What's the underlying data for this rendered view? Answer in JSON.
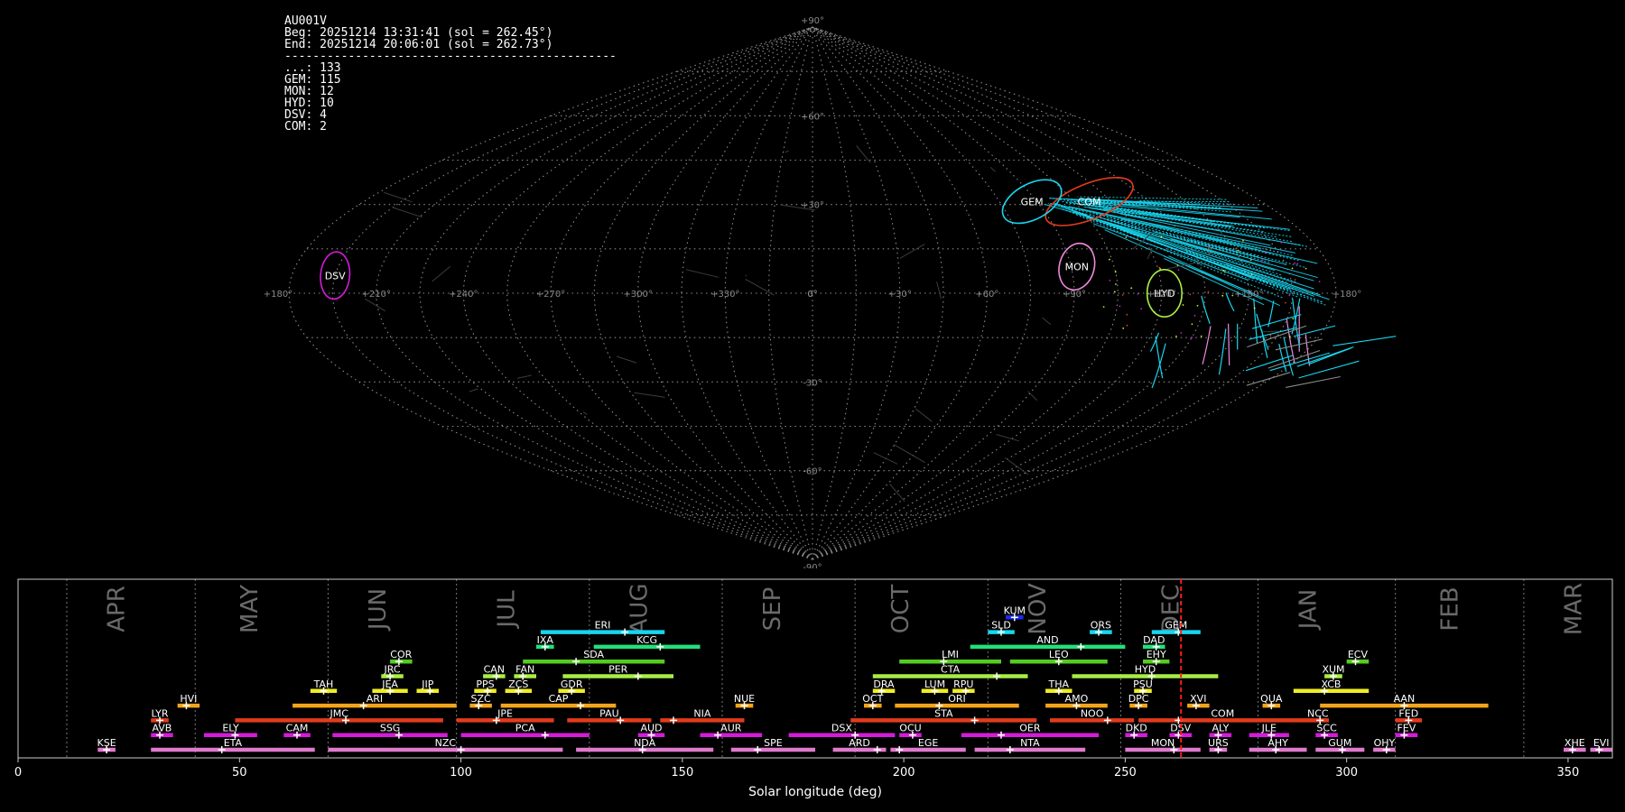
{
  "info": {
    "station": "AU001V",
    "beg": "Beg: 20251214 13:31:41 (sol = 262.45°)",
    "end": "End: 20251214 20:06:01 (sol = 262.73°)",
    "separator": "-----------------------------------------------",
    "counts": [
      "...: 133",
      "GEM: 115",
      "MON: 12",
      "HYD: 10",
      "DSV: 4",
      "COM: 2"
    ]
  },
  "sky_map": {
    "projection": "sinusoidal",
    "lat_labels": [
      "+90°",
      "+60°",
      "+30°",
      "0°",
      "-30°",
      "-60°",
      "-90°"
    ],
    "lat_values": [
      90,
      60,
      30,
      0,
      -30,
      -60,
      -90
    ],
    "lon_labels": [
      {
        "lon": 180,
        "text": "+180°"
      },
      {
        "lon": 150,
        "text": "+150°"
      },
      {
        "lon": 120,
        "text": "+120°"
      },
      {
        "lon": 90,
        "text": "+90°"
      },
      {
        "lon": 60,
        "text": "+60°"
      },
      {
        "lon": 30,
        "text": "+30°"
      },
      {
        "lon": 0,
        "text": "0°"
      },
      {
        "lon": -30,
        "text": "+330°"
      },
      {
        "lon": -60,
        "text": "+300°"
      },
      {
        "lon": -90,
        "text": "+270°"
      },
      {
        "lon": -120,
        "text": "+240°"
      },
      {
        "lon": -150,
        "text": "+210°"
      },
      {
        "lon": -180,
        "text": "+180°"
      }
    ],
    "radiants": [
      {
        "code": "COM",
        "lon": 111,
        "lat": 31,
        "rx_deg": 16,
        "ry_deg": 6,
        "angle": -22,
        "color": "#e33b1c"
      },
      {
        "code": "GEM",
        "lon": 88,
        "lat": 31,
        "rx_deg": 11,
        "ry_deg": 6,
        "angle": -28,
        "color": "#18d5ee"
      },
      {
        "code": "MON",
        "lon": 92,
        "lat": 9,
        "rx_deg": 6,
        "ry_deg": 8,
        "angle": 15,
        "color": "#ee88dd"
      },
      {
        "code": "HYD",
        "lon": 121,
        "lat": 0,
        "rx_deg": 6,
        "ry_deg": 8,
        "angle": 0,
        "color": "#a8ee44"
      },
      {
        "code": "DSV",
        "lon": -165,
        "lat": 6,
        "rx_deg": 5,
        "ry_deg": 8,
        "angle": 5,
        "color": "#d41cd8"
      }
    ]
  },
  "timeline": {
    "xlabel": "Solar longitude (deg)",
    "xlim": [
      0,
      360
    ],
    "xticks": [
      0,
      50,
      100,
      150,
      200,
      250,
      300,
      350
    ],
    "current_sol": 262.6,
    "months": [
      {
        "name": "APR",
        "sol": 24
      },
      {
        "name": "MAY",
        "sol": 54
      },
      {
        "name": "JUN",
        "sol": 83
      },
      {
        "name": "JUL",
        "sol": 112
      },
      {
        "name": "AUG",
        "sol": 142
      },
      {
        "name": "SEP",
        "sol": 172
      },
      {
        "name": "OCT",
        "sol": 201
      },
      {
        "name": "NOV",
        "sol": 232
      },
      {
        "name": "DEC",
        "sol": 262
      },
      {
        "name": "JAN",
        "sol": 293
      },
      {
        "name": "FEB",
        "sol": 325
      },
      {
        "name": "MAR",
        "sol": 353
      }
    ],
    "month_boundaries": [
      11,
      40,
      70,
      99,
      129,
      159,
      189,
      219,
      249,
      280,
      311,
      340
    ],
    "showers": [
      {
        "code": "KUM",
        "start": 223,
        "end": 227,
        "peak": 225,
        "row": 9,
        "color": "#1a2aee"
      },
      {
        "code": "ERI",
        "start": 118,
        "end": 146,
        "peak": 137,
        "row": 8,
        "color": "#18d5ee"
      },
      {
        "code": "SLD",
        "start": 219,
        "end": 225,
        "peak": 222,
        "row": 8,
        "color": "#18d5ee"
      },
      {
        "code": "ORS",
        "start": 242,
        "end": 247,
        "peak": 244,
        "row": 8,
        "color": "#18d5ee"
      },
      {
        "code": "GEM",
        "start": 256,
        "end": 267,
        "peak": 262,
        "row": 8,
        "color": "#18d5ee"
      },
      {
        "code": "IXA",
        "start": 117,
        "end": 121,
        "peak": 119,
        "row": 7,
        "color": "#22e07a"
      },
      {
        "code": "KCG",
        "start": 130,
        "end": 154,
        "peak": 145,
        "row": 7,
        "color": "#22e07a"
      },
      {
        "code": "AND",
        "start": 215,
        "end": 250,
        "peak": 240,
        "row": 7,
        "color": "#22e07a"
      },
      {
        "code": "DAD",
        "start": 254,
        "end": 259,
        "peak": 257,
        "row": 7,
        "color": "#22e07a"
      },
      {
        "code": "COR",
        "start": 84,
        "end": 89,
        "peak": 86,
        "row": 6,
        "color": "#55cc22"
      },
      {
        "code": "SDA",
        "start": 114,
        "end": 146,
        "peak": 126,
        "row": 6,
        "color": "#55cc22"
      },
      {
        "code": "LMI",
        "start": 199,
        "end": 222,
        "peak": 209,
        "row": 6,
        "color": "#55cc22"
      },
      {
        "code": "LEO",
        "start": 224,
        "end": 246,
        "peak": 235,
        "row": 6,
        "color": "#55cc22"
      },
      {
        "code": "EHY",
        "start": 254,
        "end": 260,
        "peak": 257,
        "row": 6,
        "color": "#55cc22"
      },
      {
        "code": "ECV",
        "start": 300,
        "end": 305,
        "peak": 302,
        "row": 6,
        "color": "#55cc22"
      },
      {
        "code": "JRC",
        "start": 82,
        "end": 87,
        "peak": 84,
        "row": 5,
        "color": "#a8ee44"
      },
      {
        "code": "CAN",
        "start": 105,
        "end": 110,
        "peak": 108,
        "row": 5,
        "color": "#a8ee44"
      },
      {
        "code": "FAN",
        "start": 112,
        "end": 117,
        "peak": 114,
        "row": 5,
        "color": "#a8ee44"
      },
      {
        "code": "PER",
        "start": 123,
        "end": 148,
        "peak": 140,
        "row": 5,
        "color": "#a8ee44"
      },
      {
        "code": "CTA",
        "start": 193,
        "end": 228,
        "peak": 221,
        "row": 5,
        "color": "#a8ee44"
      },
      {
        "code": "HYD",
        "start": 238,
        "end": 271,
        "peak": 256,
        "row": 5,
        "color": "#a8ee44"
      },
      {
        "code": "XUM",
        "start": 295,
        "end": 299,
        "peak": 297,
        "row": 5,
        "color": "#a8ee44"
      },
      {
        "code": "TAH",
        "start": 66,
        "end": 72,
        "peak": 69,
        "row": 4,
        "color": "#eeee22"
      },
      {
        "code": "JEA",
        "start": 80,
        "end": 88,
        "peak": 84,
        "row": 4,
        "color": "#eeee22"
      },
      {
        "code": "JIP",
        "start": 90,
        "end": 95,
        "peak": 93,
        "row": 4,
        "color": "#eeee22"
      },
      {
        "code": "PPS",
        "start": 103,
        "end": 108,
        "peak": 106,
        "row": 4,
        "color": "#eeee22"
      },
      {
        "code": "ZCS",
        "start": 110,
        "end": 116,
        "peak": 113,
        "row": 4,
        "color": "#eeee22"
      },
      {
        "code": "GDR",
        "start": 122,
        "end": 128,
        "peak": 125,
        "row": 4,
        "color": "#eeee22"
      },
      {
        "code": "DRA",
        "start": 193,
        "end": 198,
        "peak": 195,
        "row": 4,
        "color": "#eeee22"
      },
      {
        "code": "LUM",
        "start": 204,
        "end": 210,
        "peak": 207,
        "row": 4,
        "color": "#eeee22"
      },
      {
        "code": "RPU",
        "start": 211,
        "end": 216,
        "peak": 214,
        "row": 4,
        "color": "#eeee22"
      },
      {
        "code": "THA",
        "start": 232,
        "end": 238,
        "peak": 235,
        "row": 4,
        "color": "#eeee22"
      },
      {
        "code": "PSU",
        "start": 252,
        "end": 256,
        "peak": 254,
        "row": 4,
        "color": "#eeee22"
      },
      {
        "code": "XCB",
        "start": 288,
        "end": 305,
        "peak": 295,
        "row": 4,
        "color": "#eeee22"
      },
      {
        "code": "HVI",
        "start": 36,
        "end": 41,
        "peak": 38,
        "row": 3,
        "color": "#f2a41c"
      },
      {
        "code": "ARI",
        "start": 62,
        "end": 99,
        "peak": 78,
        "row": 3,
        "color": "#f2a41c"
      },
      {
        "code": "SZC",
        "start": 102,
        "end": 107,
        "peak": 104,
        "row": 3,
        "color": "#f2a41c"
      },
      {
        "code": "CAP",
        "start": 109,
        "end": 135,
        "peak": 127,
        "row": 3,
        "color": "#f2a41c"
      },
      {
        "code": "NUE",
        "start": 162,
        "end": 166,
        "peak": 164,
        "row": 3,
        "color": "#f2a41c"
      },
      {
        "code": "OCT",
        "start": 191,
        "end": 195,
        "peak": 193,
        "row": 3,
        "color": "#f2a41c"
      },
      {
        "code": "ORI",
        "start": 198,
        "end": 226,
        "peak": 208,
        "row": 3,
        "color": "#f2a41c"
      },
      {
        "code": "AMO",
        "start": 232,
        "end": 246,
        "peak": 239,
        "row": 3,
        "color": "#f2a41c"
      },
      {
        "code": "DPC",
        "start": 251,
        "end": 255,
        "peak": 253,
        "row": 3,
        "color": "#f2a41c"
      },
      {
        "code": "XVI",
        "start": 264,
        "end": 269,
        "peak": 266,
        "row": 3,
        "color": "#f2a41c"
      },
      {
        "code": "QUA",
        "start": 281,
        "end": 285,
        "peak": 283,
        "row": 3,
        "color": "#f2a41c"
      },
      {
        "code": "AAN",
        "start": 294,
        "end": 332,
        "peak": 313,
        "row": 3,
        "color": "#f2a41c"
      },
      {
        "code": "LYR",
        "start": 30,
        "end": 34,
        "peak": 32,
        "row": 2,
        "color": "#e33b1c"
      },
      {
        "code": "JMC",
        "start": 49,
        "end": 96,
        "peak": 74,
        "row": 2,
        "color": "#e33b1c"
      },
      {
        "code": "JPE",
        "start": 99,
        "end": 121,
        "peak": 108,
        "row": 2,
        "color": "#e33b1c"
      },
      {
        "code": "PAU",
        "start": 124,
        "end": 143,
        "peak": 136,
        "row": 2,
        "color": "#e33b1c"
      },
      {
        "code": "NIA",
        "start": 145,
        "end": 164,
        "peak": 148,
        "row": 2,
        "color": "#e33b1c"
      },
      {
        "code": "STA",
        "start": 188,
        "end": 230,
        "peak": 216,
        "row": 2,
        "color": "#e33b1c"
      },
      {
        "code": "NOO",
        "start": 233,
        "end": 252,
        "peak": 246,
        "row": 2,
        "color": "#e33b1c"
      },
      {
        "code": "COM",
        "start": 253,
        "end": 291,
        "peak": 262,
        "row": 2,
        "color": "#e33b1c"
      },
      {
        "code": "NCC",
        "start": 291,
        "end": 296,
        "peak": 294,
        "row": 2,
        "color": "#e33b1c"
      },
      {
        "code": "FED",
        "start": 311,
        "end": 317,
        "peak": 314,
        "row": 2,
        "color": "#e33b1c"
      },
      {
        "code": "AVB",
        "start": 30,
        "end": 35,
        "peak": 32,
        "row": 1,
        "color": "#d41cd8"
      },
      {
        "code": "ELY",
        "start": 42,
        "end": 54,
        "peak": 49,
        "row": 1,
        "color": "#d41cd8"
      },
      {
        "code": "CAM",
        "start": 60,
        "end": 66,
        "peak": 63,
        "row": 1,
        "color": "#d41cd8"
      },
      {
        "code": "SSG",
        "start": 71,
        "end": 97,
        "peak": 86,
        "row": 1,
        "color": "#d41cd8"
      },
      {
        "code": "PCA",
        "start": 100,
        "end": 129,
        "peak": 119,
        "row": 1,
        "color": "#d41cd8"
      },
      {
        "code": "AUD",
        "start": 140,
        "end": 146,
        "peak": 143,
        "row": 1,
        "color": "#d41cd8"
      },
      {
        "code": "AUR",
        "start": 154,
        "end": 168,
        "peak": 158,
        "row": 1,
        "color": "#d41cd8"
      },
      {
        "code": "DSX",
        "start": 174,
        "end": 198,
        "peak": 189,
        "row": 1,
        "color": "#d41cd8"
      },
      {
        "code": "OCU",
        "start": 199,
        "end": 204,
        "peak": 202,
        "row": 1,
        "color": "#d41cd8"
      },
      {
        "code": "OER",
        "start": 213,
        "end": 244,
        "peak": 222,
        "row": 1,
        "color": "#d41cd8"
      },
      {
        "code": "DKD",
        "start": 250,
        "end": 255,
        "peak": 252,
        "row": 1,
        "color": "#d41cd8"
      },
      {
        "code": "DSV",
        "start": 260,
        "end": 265,
        "peak": 262,
        "row": 1,
        "color": "#d41cd8"
      },
      {
        "code": "ALY",
        "start": 269,
        "end": 274,
        "peak": 271,
        "row": 1,
        "color": "#d41cd8"
      },
      {
        "code": "JLE",
        "start": 278,
        "end": 287,
        "peak": 283,
        "row": 1,
        "color": "#d41cd8"
      },
      {
        "code": "SCC",
        "start": 293,
        "end": 298,
        "peak": 295,
        "row": 1,
        "color": "#d41cd8"
      },
      {
        "code": "FEV",
        "start": 311,
        "end": 316,
        "peak": 313,
        "row": 1,
        "color": "#d41cd8"
      },
      {
        "code": "KSE",
        "start": 18,
        "end": 22,
        "peak": 20,
        "row": 0,
        "color": "#e07acc"
      },
      {
        "code": "ETA",
        "start": 30,
        "end": 67,
        "peak": 46,
        "row": 0,
        "color": "#e07acc"
      },
      {
        "code": "NZC",
        "start": 70,
        "end": 123,
        "peak": 100,
        "row": 0,
        "color": "#e07acc"
      },
      {
        "code": "NDA",
        "start": 126,
        "end": 157,
        "peak": 141,
        "row": 0,
        "color": "#e07acc"
      },
      {
        "code": "SPE",
        "start": 161,
        "end": 180,
        "peak": 167,
        "row": 0,
        "color": "#e07acc"
      },
      {
        "code": "ARD",
        "start": 184,
        "end": 196,
        "peak": 194,
        "row": 0,
        "color": "#e07acc"
      },
      {
        "code": "EGE",
        "start": 197,
        "end": 214,
        "peak": 199,
        "row": 0,
        "color": "#e07acc"
      },
      {
        "code": "NTA",
        "start": 216,
        "end": 241,
        "peak": 224,
        "row": 0,
        "color": "#e07acc"
      },
      {
        "code": "MON",
        "start": 250,
        "end": 267,
        "peak": 261,
        "row": 0,
        "color": "#e07acc"
      },
      {
        "code": "URS",
        "start": 269,
        "end": 273,
        "peak": 271,
        "row": 0,
        "color": "#e07acc"
      },
      {
        "code": "AHY",
        "start": 278,
        "end": 291,
        "peak": 284,
        "row": 0,
        "color": "#e07acc"
      },
      {
        "code": "GUM",
        "start": 293,
        "end": 304,
        "peak": 299,
        "row": 0,
        "color": "#e07acc"
      },
      {
        "code": "OHY",
        "start": 306,
        "end": 311,
        "peak": 309,
        "row": 0,
        "color": "#e07acc"
      },
      {
        "code": "XHE",
        "start": 349,
        "end": 354,
        "peak": 351,
        "row": 0,
        "color": "#e07acc"
      },
      {
        "code": "EVI",
        "start": 355,
        "end": 360,
        "peak": 357,
        "row": 0,
        "color": "#e07acc"
      }
    ]
  },
  "chart_data": [
    {
      "type": "scatter",
      "title": "",
      "projection": "sinusoidal",
      "lat_range": [
        -90,
        90
      ],
      "lon_range": [
        180,
        -180
      ],
      "grid": true,
      "radiant_regions": [
        "COM",
        "GEM",
        "MON",
        "HYD",
        "DSV"
      ],
      "counts": {
        "...": 133,
        "GEM": 115,
        "MON": 12,
        "HYD": 10,
        "DSV": 4,
        "COM": 2
      }
    },
    {
      "type": "bar",
      "orientation": "horizontal-ranges",
      "xlabel": "Solar longitude (deg)",
      "xlim": [
        0,
        360
      ],
      "grid": "month boundaries dotted",
      "current_sol": 262.6
    }
  ]
}
